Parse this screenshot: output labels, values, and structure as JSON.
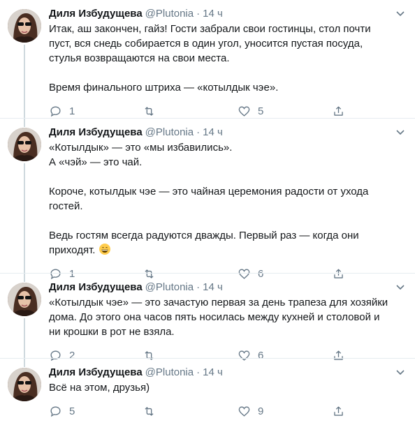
{
  "tweets": [
    {
      "name": "Диля Избудущева",
      "handle": "@Plutonia",
      "sep": "·",
      "time": "14 ч",
      "text": "Итак, аш закончен, гайз! Гости забрали свои гостинцы, стол почти\nпуст, вся снедь собирается в один угол, уносится пустая посуда,\nстулья возвращаются на свои места.\n\nВремя финального штриха — «котылдык чэе».",
      "replies": "1",
      "retweets": "",
      "likes": "5"
    },
    {
      "name": "Диля Избудущева",
      "handle": "@Plutonia",
      "sep": "·",
      "time": "14 ч",
      "text": "«Котылдык» — это «мы избавились».\nА «чэй» — это чай.\n\nКороче, котылдык чэе — это чайная церемония радости от ухода\nгостей.\n\nВедь гостям всегда радуются дважды. Первый раз — когда они\nприходят.",
      "replies": "1",
      "retweets": "",
      "likes": "6"
    },
    {
      "name": "Диля Избудущева",
      "handle": "@Plutonia",
      "sep": "·",
      "time": "14 ч",
      "text": "«Котылдык чэе» — это зачастую первая за день трапеза для хозяйки\nдома. До этого она часов пять носилась между кухней и столовой и\nни крошки в рот не взяла.",
      "replies": "2",
      "retweets": "",
      "likes": "6"
    },
    {
      "name": "Диля Избудущева",
      "handle": "@Plutonia",
      "sep": "·",
      "time": "14 ч",
      "text": "Всё на этом, друзья)",
      "replies": "5",
      "retweets": "",
      "likes": "9"
    }
  ],
  "colors": {
    "muted": "#657786",
    "text": "#14171a",
    "line": "#cfd9de",
    "separator": "#e6ecf0"
  }
}
